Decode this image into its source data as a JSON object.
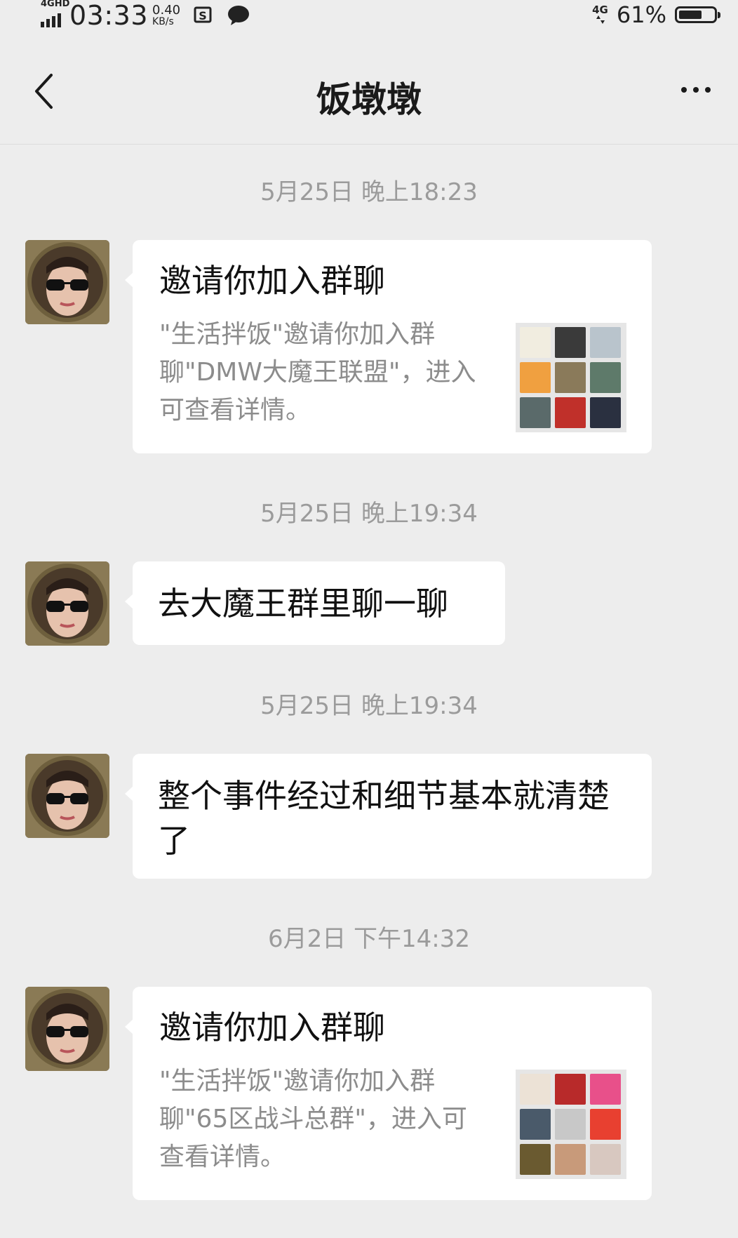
{
  "status_bar": {
    "network_type": "4GHD",
    "time": "03:33",
    "speed_value": "0.40",
    "speed_unit": "KB/s",
    "mobile_data": "4G",
    "battery_percent": "61%"
  },
  "header": {
    "title": "饭墩墩",
    "back_icon": "chevron-left-icon",
    "more_icon": "more-dots-icon"
  },
  "messages": [
    {
      "timestamp": "5月25日 晚上18:23",
      "type": "group_invite",
      "title": "邀请你加入群聊",
      "description": "\"生活拌饭\"邀请你加入群聊\"DMW大魔王联盟\"，进入可查看详情。",
      "thumbnail_colors": [
        "#f1ede0",
        "#3a3a3a",
        "#b9c4cc",
        "#f0a040",
        "#8a7a5a",
        "#5e7a6a",
        "#5a6a6a",
        "#c0302a",
        "#2a3040"
      ]
    },
    {
      "timestamp": "5月25日 晚上19:34",
      "type": "text",
      "text": "去大魔王群里聊一聊"
    },
    {
      "timestamp": "5月25日 晚上19:34",
      "type": "text",
      "text": "整个事件经过和细节基本就清楚了"
    },
    {
      "timestamp": "6月2日 下午14:32",
      "type": "group_invite",
      "title": "邀请你加入群聊",
      "description": "\"生活拌饭\"邀请你加入群聊\"65区战斗总群\"，进入可查看详情。",
      "thumbnail_colors": [
        "#ece2d6",
        "#b82a2a",
        "#e8508a",
        "#4a5a6a",
        "#c8c8c8",
        "#e84030",
        "#6a5a30",
        "#c89a7a",
        "#d8c8c0"
      ]
    }
  ],
  "colors": {
    "background": "#ededed",
    "bubble": "#ffffff",
    "timestamp_text": "#9b9b9b",
    "description_text": "#8c8c8c"
  }
}
